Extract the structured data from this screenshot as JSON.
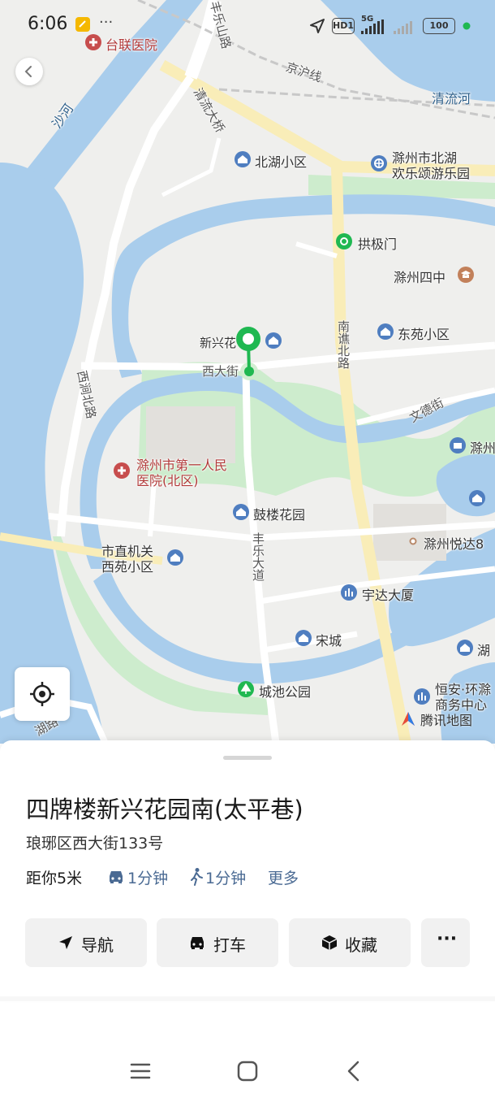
{
  "status_bar": {
    "time": "6:06",
    "hd_badge": "HD1",
    "network": "5G",
    "battery": "100",
    "dots": "···"
  },
  "map": {
    "labels": {
      "tailian_hospital": "台联医院",
      "qingliu_river": "清流河",
      "jinghu_line": "京沪线",
      "sha_river": "沙河",
      "qingliu_bridge": "清流大桥",
      "fengle_road_top": "丰乐山路",
      "beihu_community": "北湖小区",
      "park_line1": "滁州市北湖",
      "park_line2": "欢乐颂游乐园",
      "gongji_gate": "拱极门",
      "no4_school": "滁州四中",
      "xinxing": "新兴花",
      "xida_street": "西大街",
      "nanqiao_road": "南谯北路",
      "dongyuan": "东苑小区",
      "xijian_road": "西涧北路",
      "wende_street": "文德街",
      "chuzhou_right": "滁州",
      "hospital_line1": "滁州市第一人民",
      "hospital_line2": "医院(北区)",
      "gulou_garden": "鼓楼花园",
      "yueda": "滁州悦达8",
      "govt_line1": "市直机关",
      "govt_line2": "西苑小区",
      "fengle_avenue": "丰乐大道",
      "yuda_building": "宇达大厦",
      "song_city": "宋城",
      "hu_right": "湖",
      "chengchi_park": "城池公园",
      "hengan_line1": "恒安·环滁",
      "hengan_line2": "商务中心",
      "lake_road": "湖路",
      "brand": "腾讯地图"
    },
    "colors": {
      "water": "#a9cdec",
      "green": "#cdeccd",
      "road": "#ffffff",
      "main_road": "#f9edb8",
      "pin": "#1fb851"
    }
  },
  "place": {
    "title": "四牌楼新兴花园南(太平巷)",
    "address": "琅琊区西大街133号",
    "distance": "距你5米",
    "drive_time": "1分钟",
    "walk_time": "1分钟",
    "more": "更多"
  },
  "actions": {
    "navigate": "导航",
    "taxi": "打车",
    "favorite": "收藏",
    "more": "···"
  }
}
